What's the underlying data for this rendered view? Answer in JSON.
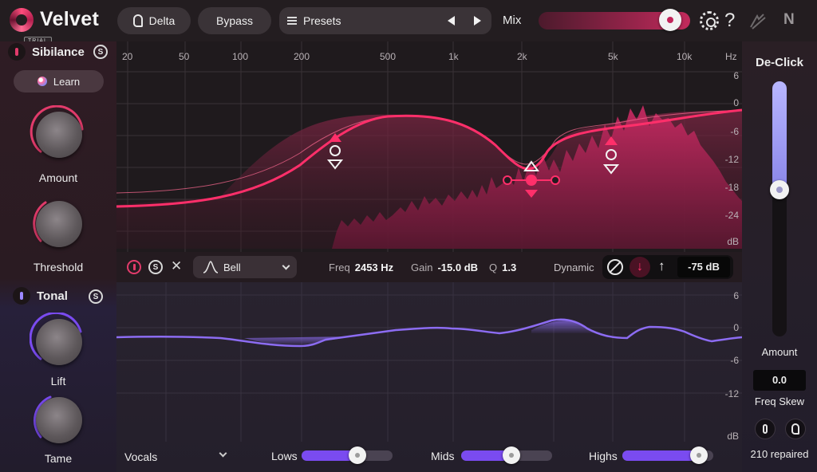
{
  "app": {
    "name": "Velvet",
    "trial_badge": "TRIAL"
  },
  "toolbar": {
    "delta_label": "Delta",
    "bypass_label": "Bypass",
    "presets_label": "Presets",
    "mix_label": "Mix",
    "mix_value": 0.93,
    "help_glyph": "?",
    "brand_glyph": "N"
  },
  "sibilance": {
    "title": "Sibilance",
    "solo_label": "S",
    "learn_label": "Learn",
    "amount_label": "Amount",
    "threshold_label": "Threshold"
  },
  "eq": {
    "freq_labels": [
      "20",
      "50",
      "100",
      "200",
      "500",
      "1k",
      "2k",
      "5k",
      "10k",
      "Hz"
    ],
    "db_labels": [
      "6",
      "0",
      "-6",
      "-12",
      "-18",
      "-24",
      "dB"
    ]
  },
  "band": {
    "solo_label": "S",
    "close_glyph": "✕",
    "shape": "Bell",
    "freq_label": "Freq",
    "freq_value": "2453 Hz",
    "gain_label": "Gain",
    "gain_value": "-15.0 dB",
    "q_label": "Q",
    "q_value": "1.3",
    "dynamic_label": "Dynamic",
    "dyn_down_glyph": "↓",
    "dyn_up_glyph": "↑",
    "dynamic_value": "-75 dB"
  },
  "tonal": {
    "title": "Tonal",
    "solo_label": "S",
    "lift_label": "Lift",
    "tame_label": "Tame",
    "db_labels": [
      "6",
      "0",
      "-6",
      "-12",
      "dB"
    ],
    "profile": "Vocals",
    "lows_label": "Lows",
    "lows_value": 0.64,
    "mids_label": "Mids",
    "mids_value": 0.56,
    "highs_label": "Highs",
    "highs_value": 0.92
  },
  "declick": {
    "title": "De-Click",
    "amount_label": "Amount",
    "amount_value": 0.58,
    "freq_skew_value": "0.0",
    "freq_skew_label": "Freq Skew",
    "repaired_text": "210 repaired"
  },
  "colors": {
    "sibilance_accent": "#e23b6b",
    "tonal_accent": "#7a4bf0",
    "declick_accent": "#a8a6f6"
  },
  "icons": {
    "logo": "velvet-swirl-logo",
    "delta": "ear-icon",
    "presets": "list-icon",
    "settings": "gear-icon",
    "help": "question-icon",
    "izotope": "izotope-logo",
    "ni": "native-instruments-logo"
  }
}
